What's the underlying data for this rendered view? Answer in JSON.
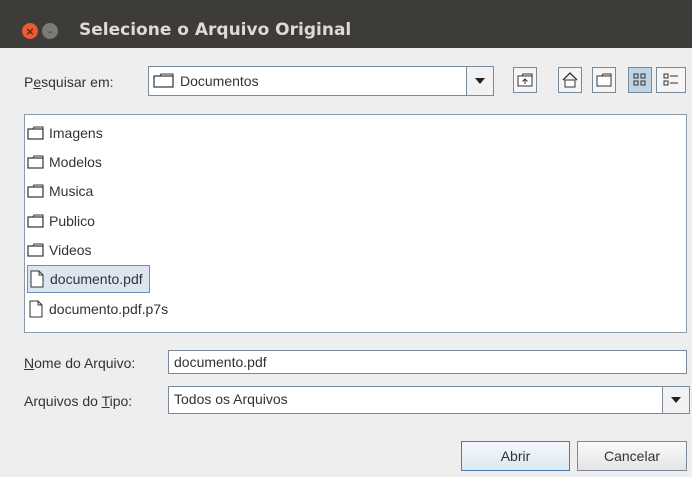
{
  "window": {
    "title": "Selecione o Arquivo Original",
    "close_glyph": "×",
    "minimize_glyph": "–"
  },
  "lookin": {
    "label_prefix": "P",
    "label_underlined": "e",
    "label_suffix": "squisar em:",
    "value": "Documentos"
  },
  "toolbar": {
    "icons": [
      "up-folder-icon",
      "home-icon",
      "new-folder-icon",
      "list-view-icon",
      "details-view-icon"
    ]
  },
  "files": [
    {
      "name": "Imagens",
      "type": "folder"
    },
    {
      "name": "Modelos",
      "type": "folder"
    },
    {
      "name": "Musica",
      "type": "folder"
    },
    {
      "name": "Publico",
      "type": "folder"
    },
    {
      "name": "Videos",
      "type": "folder"
    },
    {
      "name": "documento.pdf",
      "type": "file",
      "selected": true
    },
    {
      "name": "documento.pdf.p7s",
      "type": "file"
    }
  ],
  "filename": {
    "label_underlined": "N",
    "label_suffix": "ome do Arquivo:",
    "value": "documento.pdf"
  },
  "filetype": {
    "label_prefix": "Arquivos do ",
    "label_underlined": "T",
    "label_suffix": "ipo:",
    "value": "Todos os Arquivos"
  },
  "buttons": {
    "open": "Abrir",
    "cancel": "Cancelar"
  },
  "colors": {
    "titlebar": "#3d3c38",
    "close": "#e95b34",
    "selection": "#dbe6f2"
  }
}
